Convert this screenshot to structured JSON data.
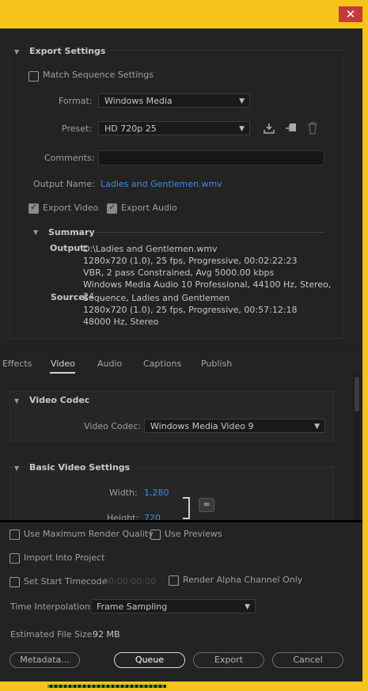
{
  "window": {
    "close_glyph": "✕"
  },
  "export_settings": {
    "title": "Export Settings",
    "match_sequence_label": "Match Sequence Settings",
    "format_label": "Format:",
    "format_value": "Windows Media",
    "preset_label": "Preset:",
    "preset_value": "HD 720p 25",
    "comments_label": "Comments:",
    "comments_value": "",
    "output_name_label": "Output Name:",
    "output_name_value": "Ladies and Gentlemen.wmv",
    "export_video_label": "Export Video",
    "export_audio_label": "Export Audio",
    "export_video_checked": true,
    "export_audio_checked": true,
    "summary": {
      "title": "Summary",
      "output_label": "Output:",
      "output_lines": [
        "D:\\Ladies and Gentlemen.wmv",
        "1280x720 (1.0), 25 fps, Progressive, 00:02:22:23",
        "VBR, 2 pass Constrained, Avg 5000.00 kbps",
        "Windows Media Audio 10 Professional, 44100 Hz, Stereo, 24 ..."
      ],
      "source_label": "Source:",
      "source_lines": [
        "Sequence, Ladies and Gentlemen",
        "1280x720 (1.0), 25 fps, Progressive, 00:57:12:18",
        "48000 Hz, Stereo"
      ]
    }
  },
  "tabs": [
    {
      "label": "Effects"
    },
    {
      "label": "Video"
    },
    {
      "label": "Audio"
    },
    {
      "label": "Captions"
    },
    {
      "label": "Publish"
    }
  ],
  "active_tab": "Video",
  "video_codec": {
    "title": "Video Codec",
    "codec_label": "Video Codec:",
    "codec_value": "Windows Media Video 9"
  },
  "basic_video": {
    "title": "Basic Video Settings",
    "width_label": "Width:",
    "width_value": "1,280",
    "height_label": "Height:",
    "height_value": "720"
  },
  "bottom": {
    "max_render_quality_label": "Use Maximum Render Quality",
    "use_previews_label": "Use Previews",
    "import_into_project_label": "Import Into Project",
    "set_start_timecode_label": "Set Start Timecode",
    "start_timecode_value": "00:00:00:00",
    "render_alpha_label": "Render Alpha Channel Only",
    "time_interpolation_label": "Time Interpolation:",
    "time_interpolation_value": "Frame Sampling",
    "estimated_size_label": "Estimated File Size:",
    "estimated_size_value": "92 MB",
    "metadata_button": "Metadata...",
    "queue_button": "Queue",
    "export_button": "Export",
    "cancel_button": "Cancel"
  },
  "icons": {
    "save_preset": "save-preset-icon",
    "import_preset": "import-preset-icon",
    "delete_preset": "trash-icon",
    "link": "link-icon"
  },
  "colors": {
    "frame": "#f6c21c",
    "link": "#3a8ee6",
    "close": "#c43b3b"
  }
}
